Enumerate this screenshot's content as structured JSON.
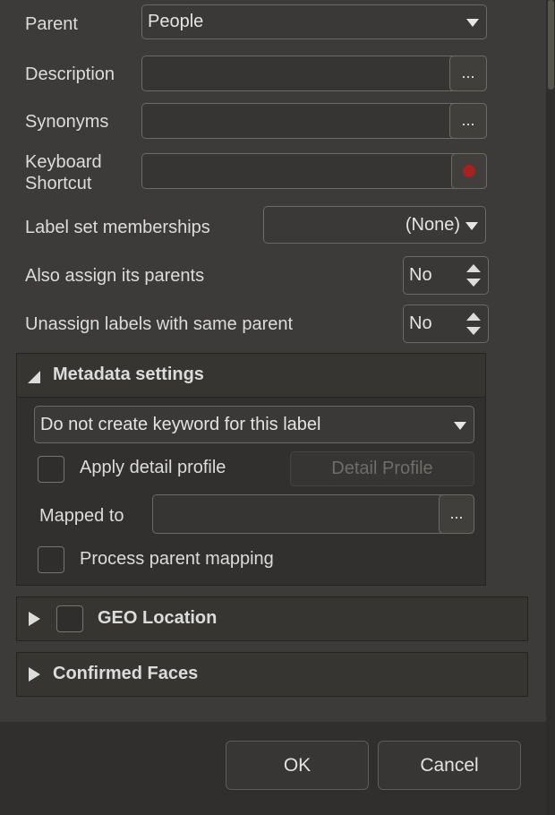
{
  "form": {
    "parent": {
      "label": "Parent",
      "value": "People"
    },
    "description": {
      "label": "Description",
      "value": "",
      "button": "..."
    },
    "synonyms": {
      "label": "Synonyms",
      "value": "",
      "button": "..."
    },
    "keyboard_shortcut": {
      "label_line1": "Keyboard",
      "label_line2": "Shortcut",
      "value": ""
    },
    "label_set": {
      "label": "Label set memberships",
      "value": "(None)"
    },
    "also_assign": {
      "label": "Also assign its parents",
      "value": "No"
    },
    "unassign": {
      "label": "Unassign labels with same parent",
      "value": "No"
    }
  },
  "metadata": {
    "title": "Metadata settings",
    "keyword_option": "Do not create keyword for this label",
    "apply_detail_label": "Apply detail profile",
    "apply_detail_checked": false,
    "detail_profile_button": "Detail Profile",
    "mapped_to_label": "Mapped to",
    "mapped_to_value": "",
    "mapped_button": "...",
    "process_parent_label": "Process parent mapping",
    "process_parent_checked": false
  },
  "geo": {
    "title": "GEO Location",
    "checked": false
  },
  "faces": {
    "title": "Confirmed Faces"
  },
  "footer": {
    "ok": "OK",
    "cancel": "Cancel"
  }
}
